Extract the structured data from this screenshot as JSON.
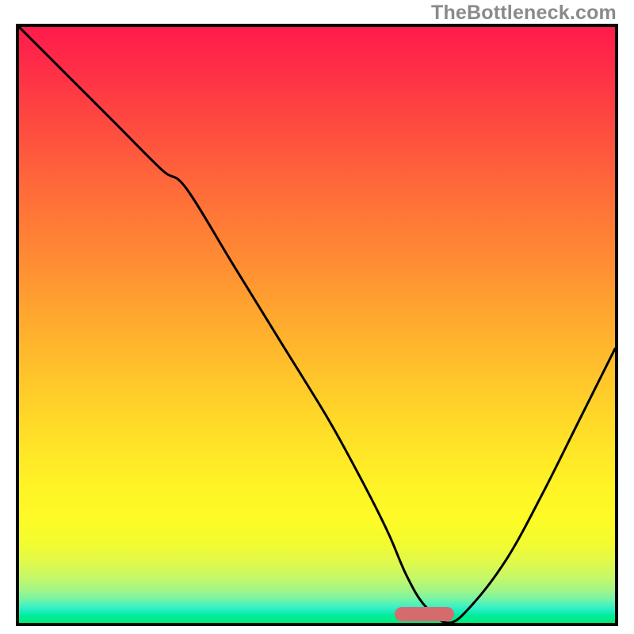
{
  "watermark": "TheBottleneck.com",
  "chart_data": {
    "type": "line",
    "title": "",
    "xlabel": "",
    "ylabel": "",
    "xlim": [
      0,
      100
    ],
    "ylim": [
      0,
      100
    ],
    "x": [
      0,
      8,
      16,
      24,
      28,
      36,
      44,
      52,
      58,
      62,
      65,
      68,
      72,
      76,
      82,
      88,
      94,
      100
    ],
    "values": [
      100,
      92,
      84,
      76,
      73,
      60,
      47,
      34,
      23,
      15,
      8,
      3,
      0,
      3,
      11,
      22,
      34,
      46
    ],
    "optimal_point_x": 68,
    "optimal_range": [
      63,
      73
    ],
    "gradient_top_color": "#ff1b4b",
    "gradient_bottom_color": "#00eb6f",
    "indicator_color": "#d66b6e"
  }
}
